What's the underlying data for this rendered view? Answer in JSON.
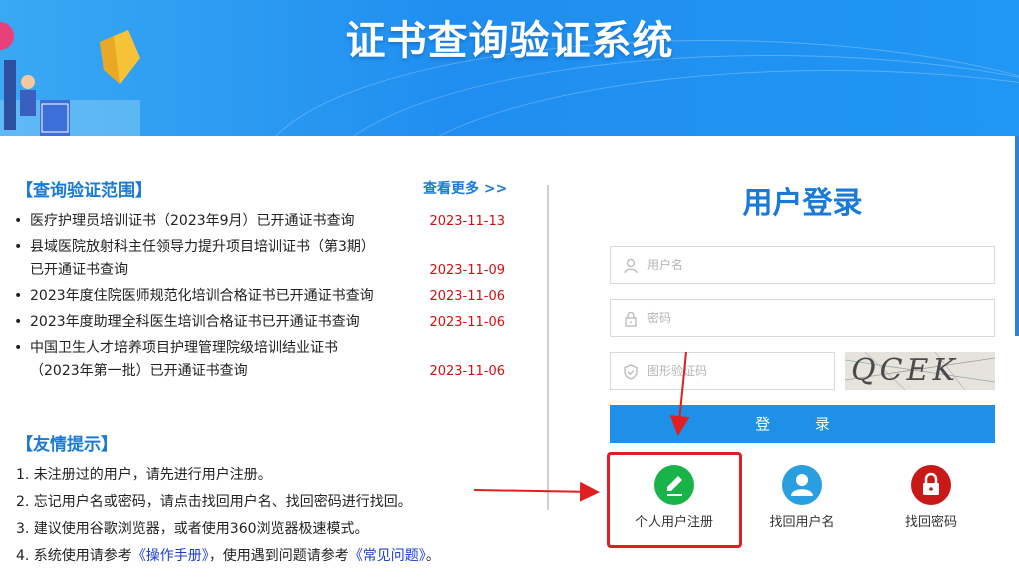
{
  "header": {
    "title": "证书查询验证系统"
  },
  "news": {
    "heading": "【查询验证范围】",
    "more_label": "查看更多 >>",
    "items": [
      {
        "text": "医疗护理员培训证书（2023年9月）已开通证书查询",
        "date": "2023-11-13"
      },
      {
        "text": "县域医院放射科主任领导力提升项目培训证书（第3期）已开通证书查询",
        "date": "2023-11-09"
      },
      {
        "text": "2023年度住院医师规范化培训合格证书已开通证书查询",
        "date": "2023-11-06"
      },
      {
        "text": "2023年度助理全科医生培训合格证书已开通证书查询",
        "date": "2023-11-06"
      },
      {
        "text": "中国卫生人才培养项目护理管理院级培训结业证书（2023年第一批）已开通证书查询",
        "date": "2023-11-06"
      }
    ]
  },
  "tips": {
    "heading": "【友情提示】",
    "items": [
      "1. 未注册过的用户，请先进行用户注册。",
      "2. 忘记用户名或密码，请点击找回用户名、找回密码进行找回。",
      "3. 建议使用谷歌浏览器，或者使用360浏览器极速模式。"
    ],
    "item4_prefix": "4. 系统使用请参考",
    "manual_link": "《操作手册》",
    "item4_middle": "，使用遇到问题请参考",
    "faq_link": "《常见问题》",
    "item4_suffix": "。"
  },
  "login": {
    "title": "用户登录",
    "username_placeholder": "用户名",
    "password_placeholder": "密码",
    "captcha_placeholder": "图形验证码",
    "captcha_text": "QCEK",
    "submit_label": "登 录",
    "actions": [
      {
        "label": "个人用户注册",
        "icon": "edit-icon",
        "color": "#1ab34a"
      },
      {
        "label": "找回用户名",
        "icon": "user-icon",
        "color": "#2a9fe0"
      },
      {
        "label": "找回密码",
        "icon": "lock-icon",
        "color": "#c81818"
      }
    ]
  },
  "colors": {
    "accent": "#1a7ad8",
    "date": "#d01010",
    "highlight": "#e02020"
  }
}
